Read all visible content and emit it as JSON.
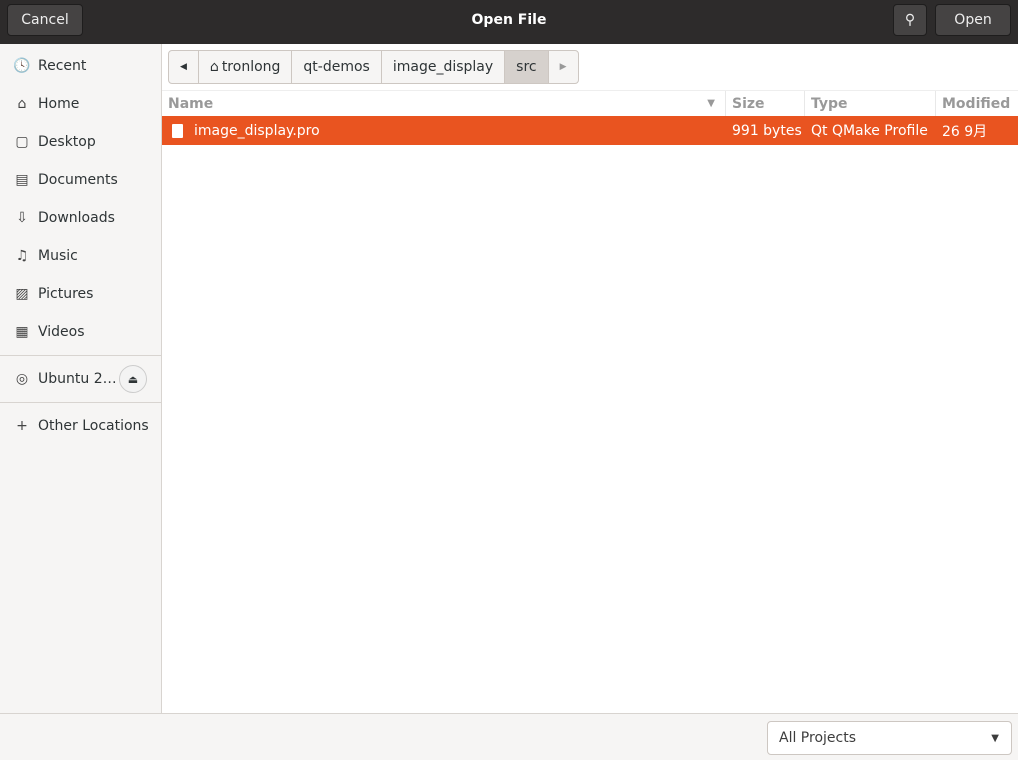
{
  "header": {
    "cancel": "Cancel",
    "title": "Open File",
    "open": "Open"
  },
  "sidebar": {
    "items": [
      {
        "label": "Recent",
        "icon": "🕓"
      },
      {
        "label": "Home",
        "icon": "⌂"
      },
      {
        "label": "Desktop",
        "icon": "▢"
      },
      {
        "label": "Documents",
        "icon": "▤"
      },
      {
        "label": "Downloads",
        "icon": "⇩"
      },
      {
        "label": "Music",
        "icon": "♫"
      },
      {
        "label": "Pictures",
        "icon": "▨"
      },
      {
        "label": "Videos",
        "icon": "▦"
      }
    ],
    "device": {
      "label": "Ubuntu 2…",
      "icon": "◎"
    },
    "other": {
      "label": "Other Locations",
      "icon": "+"
    }
  },
  "path": [
    "tronlong",
    "qt-demos",
    "image_display",
    "src"
  ],
  "columns": {
    "name": "Name",
    "size": "Size",
    "type": "Type",
    "modified": "Modified"
  },
  "files": [
    {
      "name": "image_display.pro",
      "size": "991 bytes",
      "type": "Qt QMake Profile",
      "modified": "26 9月"
    }
  ],
  "footer": {
    "filter": "All Projects"
  },
  "colors": {
    "accent": "#e95420"
  }
}
